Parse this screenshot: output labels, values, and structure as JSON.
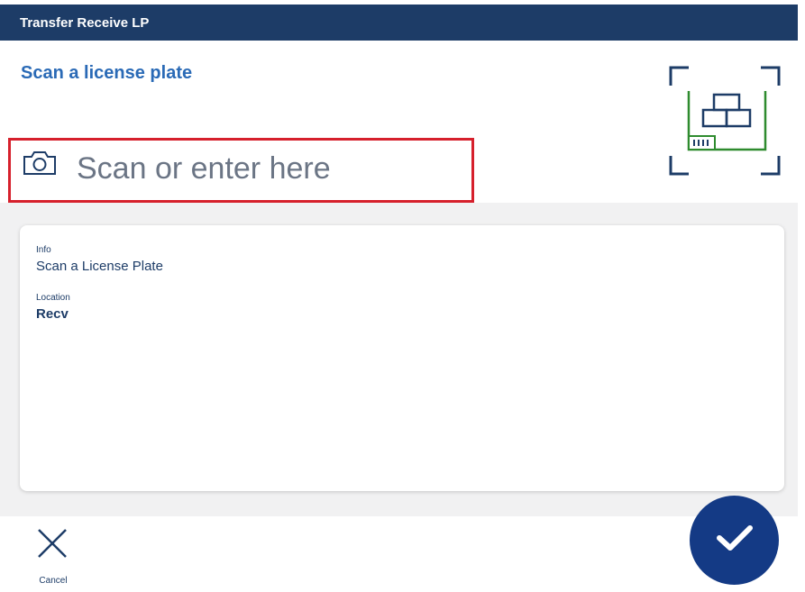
{
  "window": {
    "title": "Transfer Receive LP"
  },
  "header": {
    "prompt": "Scan a license plate",
    "scan_field": {
      "placeholder": "Scan or enter here",
      "value": ""
    }
  },
  "info_card": {
    "fields": [
      {
        "label": "Info",
        "value": "Scan a License Plate"
      },
      {
        "label": "Location",
        "value": "Recv"
      }
    ]
  },
  "footer": {
    "cancel_label": "Cancel"
  },
  "icons": {
    "camera": "camera-icon",
    "illustration": "license-plate-scan-icon",
    "cancel": "close-icon",
    "confirm": "checkmark-icon"
  },
  "colors": {
    "title_bar": "#1d3c67",
    "accent_text": "#2a6ab6",
    "highlight_border": "#d6202c",
    "confirm_button": "#143a85",
    "illustration_green": "#2e8b2e"
  }
}
